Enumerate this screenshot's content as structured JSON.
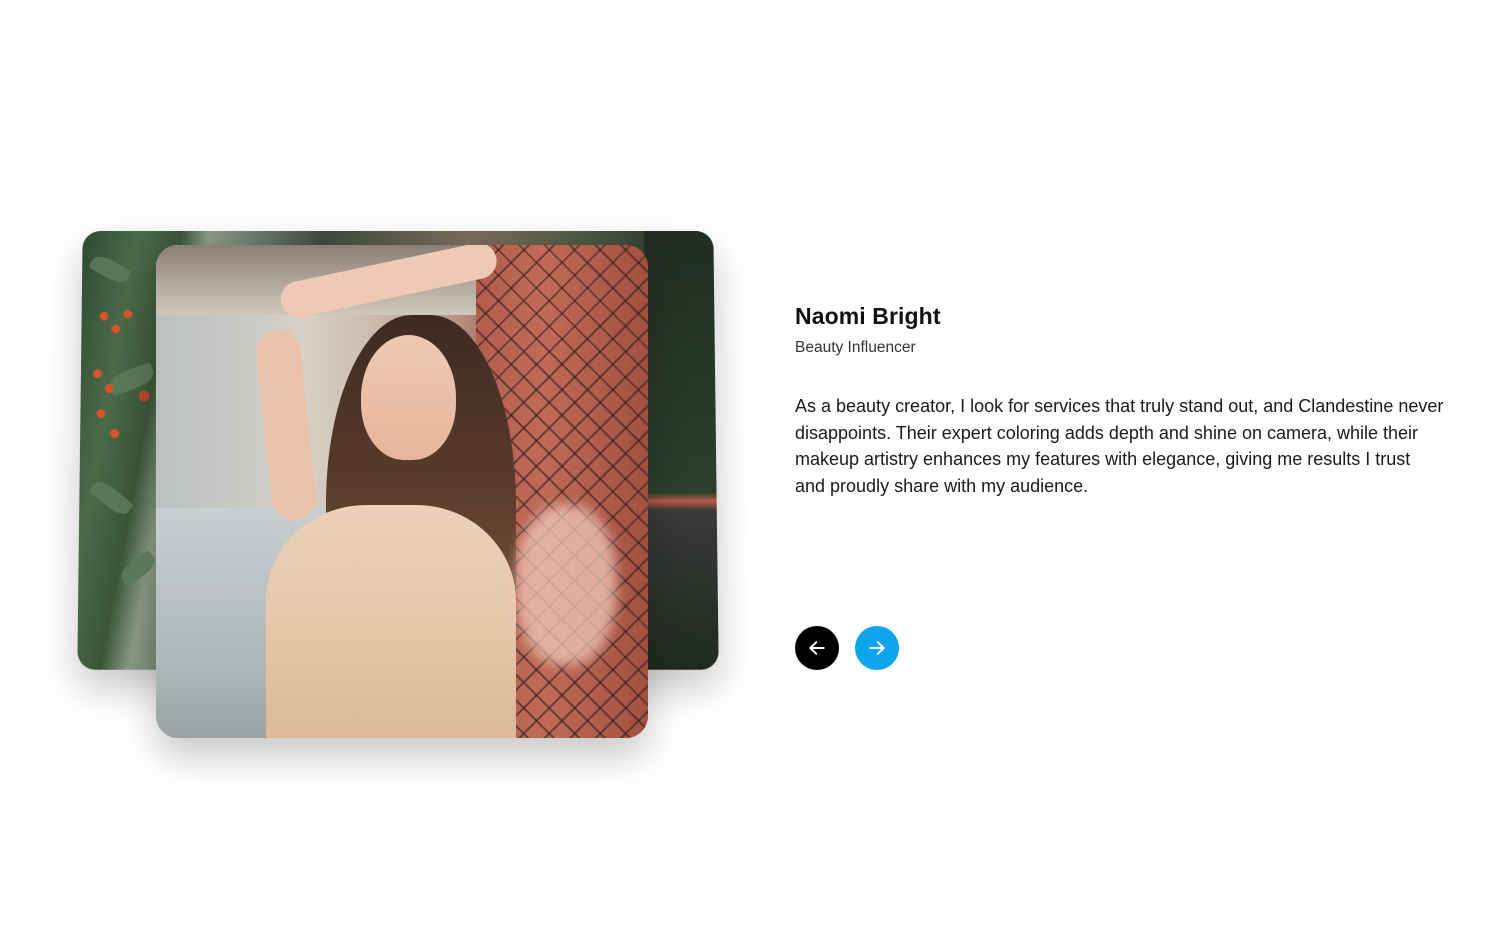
{
  "testimonial": {
    "name": "Naomi Bright",
    "role": "Beauty Influencer",
    "quote": "As a beauty creator, I look for services that truly stand out, and Clandestine never disappoints. Their expert coloring adds depth and shine on camera, while their makeup artistry enhances my features with elegance, giving me results I trust and proudly share with my audience."
  },
  "images": {
    "front": "woman-with-long-hair-photo-icon",
    "back": "garden-berries-photo-icon"
  },
  "navigation": {
    "prev_icon": "arrow-left-icon",
    "next_icon": "arrow-right-icon"
  },
  "colors": {
    "prev_button": "#000000",
    "next_button": "#0ea5ee",
    "text": "#111111"
  }
}
